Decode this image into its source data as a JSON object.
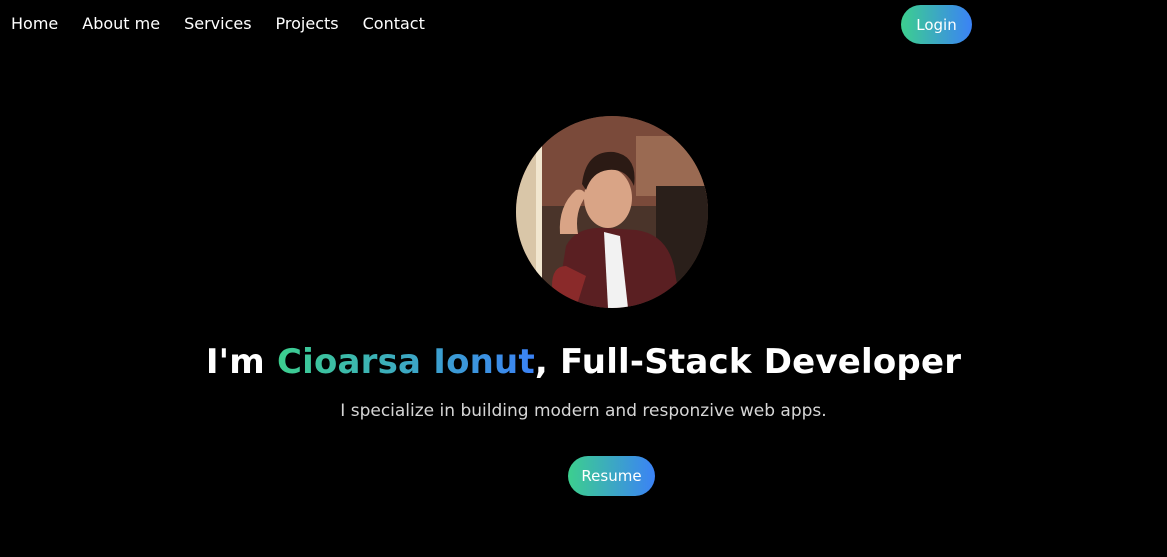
{
  "nav": {
    "items": [
      {
        "label": "Home"
      },
      {
        "label": "About me"
      },
      {
        "label": "Services"
      },
      {
        "label": "Projects"
      },
      {
        "label": "Contact"
      }
    ],
    "login_label": "Login"
  },
  "hero": {
    "headline_prefix": "I'm ",
    "name": "Cioarsa Ionut",
    "headline_suffix": ", Full-Stack Developer",
    "tagline": "I specialize in building modern and responzive web apps.",
    "resume_label": "Resume"
  },
  "colors": {
    "background": "#000000",
    "gradient_start": "#3ccf8e",
    "gradient_end": "#3b82f6",
    "text": "#ffffff",
    "muted_text": "#d6d6d6"
  }
}
